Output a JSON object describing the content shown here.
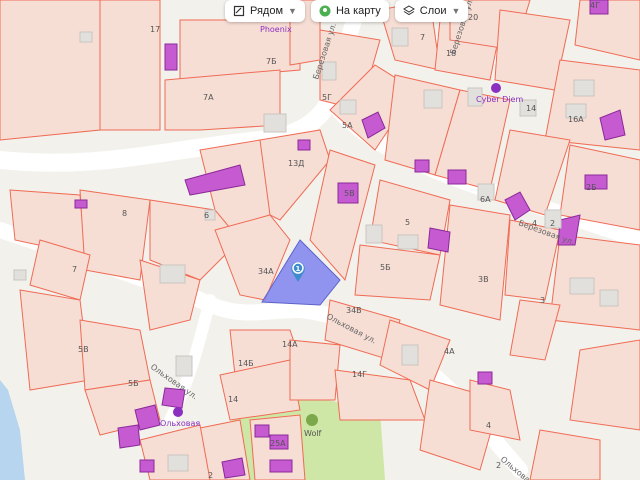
{
  "toolbar": {
    "nearby_label": "Рядом",
    "on_map_label": "На карту",
    "layers_label": "Слои"
  },
  "pois": {
    "phoenix": "Phoenix",
    "cyber_diem": "Cyber Diem",
    "olkhovaya": "Ольховая",
    "wolf": "Wolf"
  },
  "streets": {
    "berezovaya_1": "Березовая ул.",
    "berezovaya_2": "Березовая ул.",
    "berezovaya_3": "Березовая ул.",
    "olkhovaya_1": "Ольховая ул.",
    "olkhovaya_2": "Ольховая ул.",
    "olkhovaya_3": "Ольховая ул."
  },
  "marker": {
    "number": "1"
  },
  "parcels": [
    "17",
    "7Б",
    "7А",
    "5Г",
    "5А",
    "20",
    "18",
    "7",
    "14",
    "16А",
    "4Г",
    "13Д",
    "5В",
    "8",
    "6",
    "7",
    "5",
    "5Б",
    "6А",
    "4",
    "2Б",
    "2",
    "3В",
    "3",
    "34А",
    "34В",
    "5В",
    "5Б",
    "4А",
    "14А",
    "14Б",
    "14Г",
    "14",
    "4",
    "2",
    "25А",
    "2",
    "7",
    "13Д"
  ],
  "colors": {
    "background": "#f3f1ec",
    "parcel_fill": "#f7ded5",
    "parcel_border": "#ef6b54",
    "building": "#c65ad1",
    "selected_parcel": "#7e84ee",
    "water": "#b7d5ef",
    "green": "#cfe7a6",
    "road": "#ffffff",
    "marker": "#3f8ccc"
  },
  "icons": [
    "nearby-icon",
    "on-map-icon",
    "layers-icon",
    "chevron-down-icon",
    "location-marker-icon",
    "poi-icon"
  ]
}
